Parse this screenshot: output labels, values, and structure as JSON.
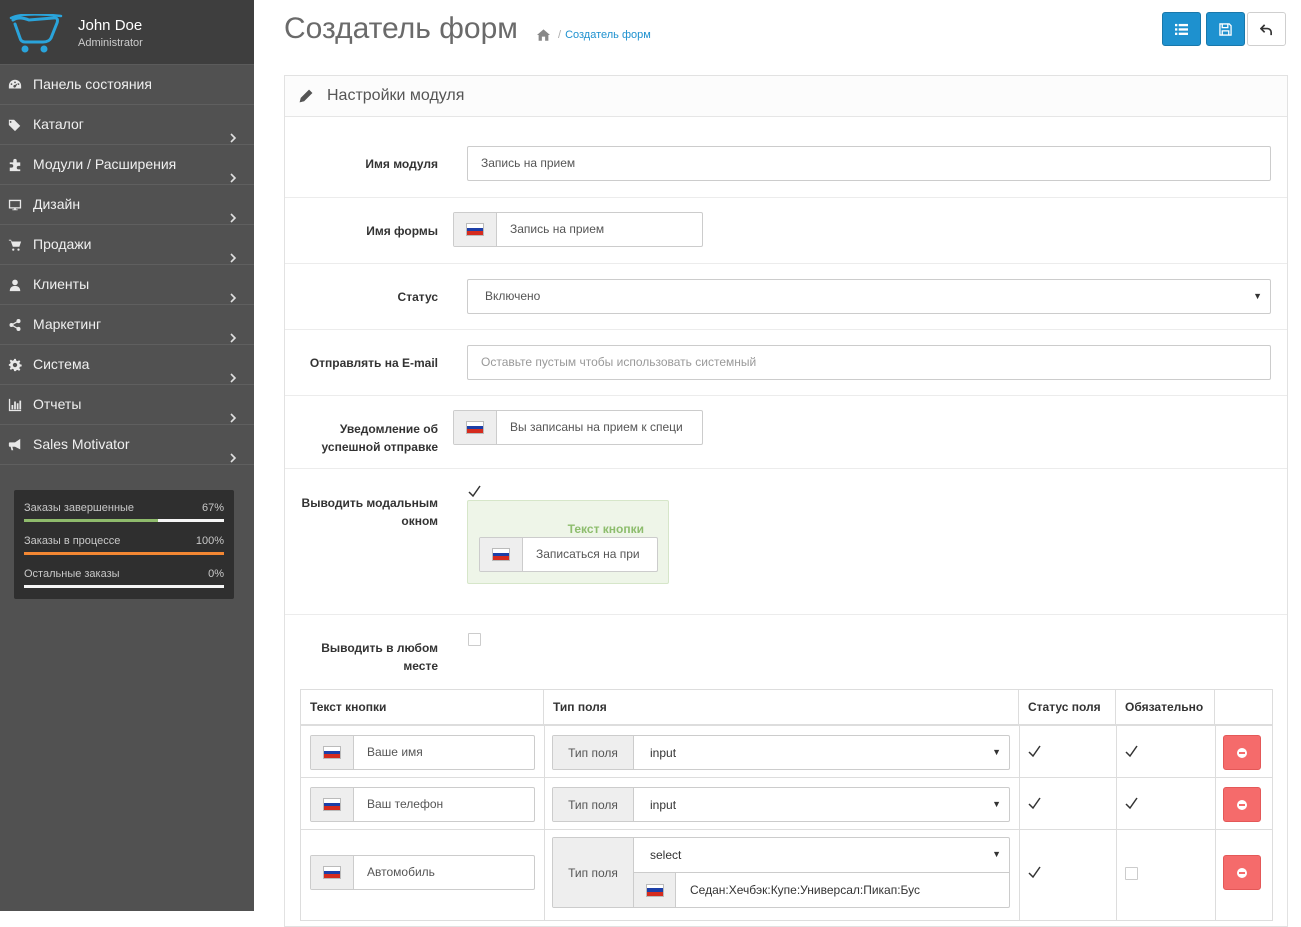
{
  "sidebar": {
    "user_name": "John Doe",
    "user_role": "Administrator",
    "menu": [
      {
        "label": "Панель состояния",
        "icon": "dashboard-icon",
        "has_children": false
      },
      {
        "label": "Каталог",
        "icon": "tags-icon",
        "has_children": true
      },
      {
        "label": "Модули / Расширения",
        "icon": "puzzle-icon",
        "has_children": true
      },
      {
        "label": "Дизайн",
        "icon": "monitor-icon",
        "has_children": true
      },
      {
        "label": "Продажи",
        "icon": "cart-icon",
        "has_children": true
      },
      {
        "label": "Клиенты",
        "icon": "user-icon",
        "has_children": true
      },
      {
        "label": "Маркетинг",
        "icon": "share-icon",
        "has_children": true
      },
      {
        "label": "Система",
        "icon": "gear-icon",
        "has_children": true
      },
      {
        "label": "Отчеты",
        "icon": "bar-chart-icon",
        "has_children": true
      },
      {
        "label": "Sales Motivator",
        "icon": "bullhorn-icon",
        "has_children": true
      }
    ],
    "stats": [
      {
        "label": "Заказы завершенные",
        "percent_text": "67%",
        "value": 0.67,
        "color": "#8fbb6c"
      },
      {
        "label": "Заказы в процессе",
        "percent_text": "100%",
        "value": 1.0,
        "color": "#f38733"
      },
      {
        "label": "Остальные заказы",
        "percent_text": "0%",
        "value": 0.0,
        "color": "#e5e5e5"
      }
    ]
  },
  "header": {
    "title": "Создатель форм",
    "breadcrumb": "Создатель форм",
    "buttons": [
      "list-icon",
      "save-icon",
      "back-icon"
    ]
  },
  "panel": {
    "title": "Настройки модуля",
    "fields": {
      "module_name": {
        "label": "Имя модуля",
        "value": "Запись на прием"
      },
      "form_name": {
        "label": "Имя формы",
        "value": "Запись на прием"
      },
      "status": {
        "label": "Статус",
        "value": "Включено"
      },
      "email": {
        "label": "Отправлять на E-mail",
        "placeholder": "Оставьте пустым чтобы использовать системный"
      },
      "success": {
        "label": "Уведомление об успешной отправке",
        "value": "Вы записаны на прием к специ"
      },
      "modal": {
        "label": "Выводить модальным окном",
        "checked": true,
        "button_text_title": "Текст кнопки",
        "button_text_value": "Записаться на при"
      },
      "anywhere": {
        "label": "Выводить в любом месте",
        "checked": false
      }
    },
    "table": {
      "headers": [
        "Текст кнопки",
        "Тип поля",
        "Статус поля",
        "Обязательно"
      ],
      "type_label": "Тип поля",
      "rows": [
        {
          "text": "Ваше имя",
          "type": "input",
          "options": null,
          "status": true,
          "required": true
        },
        {
          "text": "Ваш телефон",
          "type": "input",
          "options": null,
          "status": true,
          "required": true
        },
        {
          "text": "Автомобиль",
          "type": "select",
          "options": "Седан:Хечбэк:Купе:Универсал:Пикап:Бус",
          "status": true,
          "required": false
        }
      ]
    }
  },
  "colors": {
    "sidebar_bg": "#515151",
    "accent_blue": "#1e91cf",
    "danger": "#f56b6b",
    "flag": [
      "#ffffff",
      "#1c3fa8",
      "#d52b1e"
    ]
  }
}
